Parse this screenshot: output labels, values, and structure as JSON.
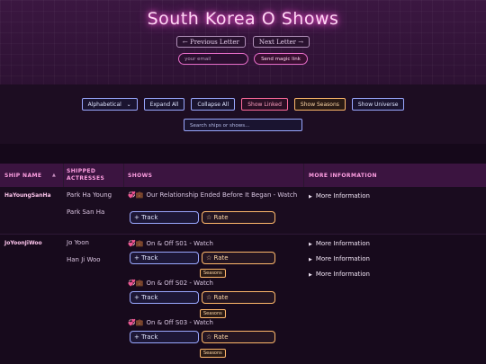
{
  "header": {
    "title": "South Korea O Shows",
    "prev_letter": "← Previous Letter",
    "next_letter": "Next Letter →",
    "email_placeholder": "your email",
    "magic_link": "Send magic link"
  },
  "controls": {
    "sort_value": "Alphabetical",
    "expand_all": "Expand All",
    "collapse_all": "Collapse All",
    "show_linked": "Show Linked",
    "show_seasons": "Show Seasons",
    "show_universe": "Show Universe",
    "search_placeholder": "Search ships or shows..."
  },
  "table": {
    "headers": [
      "SHIP NAME",
      "SHIPPED ACTRESSES",
      "SHOWS",
      "MORE INFORMATION"
    ],
    "rows": [
      {
        "ship": "HaYoungSanHa",
        "actresses": [
          "Park Ha Young",
          "Park San Ha"
        ],
        "shows": [
          {
            "title": "Our Relationship Ended Before It Began - Watch",
            "track": "+ Track",
            "rate": "☆ Rate"
          }
        ],
        "more": [
          "More Information"
        ]
      },
      {
        "ship": "JoYoonJiWoo",
        "actresses": [
          "Jo Yoon",
          "Han Ji Woo"
        ],
        "shows": [
          {
            "title": "On & Off S01 - Watch",
            "track": "+ Track",
            "rate": "☆ Rate",
            "badge": "Seasons"
          },
          {
            "title": "On & Off S02 - Watch",
            "track": "+ Track",
            "rate": "☆ Rate",
            "badge": "Seasons"
          },
          {
            "title": "On & Off S03 - Watch",
            "track": "+ Track",
            "rate": "☆ Rate",
            "badge": "Seasons"
          }
        ],
        "more": [
          "More Information",
          "More Information",
          "More Information"
        ]
      }
    ]
  },
  "icons": {
    "show_emoji": "💞💼",
    "more_triangle": "▶",
    "sort_arrow": "▲",
    "select_arrow": "⌄"
  }
}
